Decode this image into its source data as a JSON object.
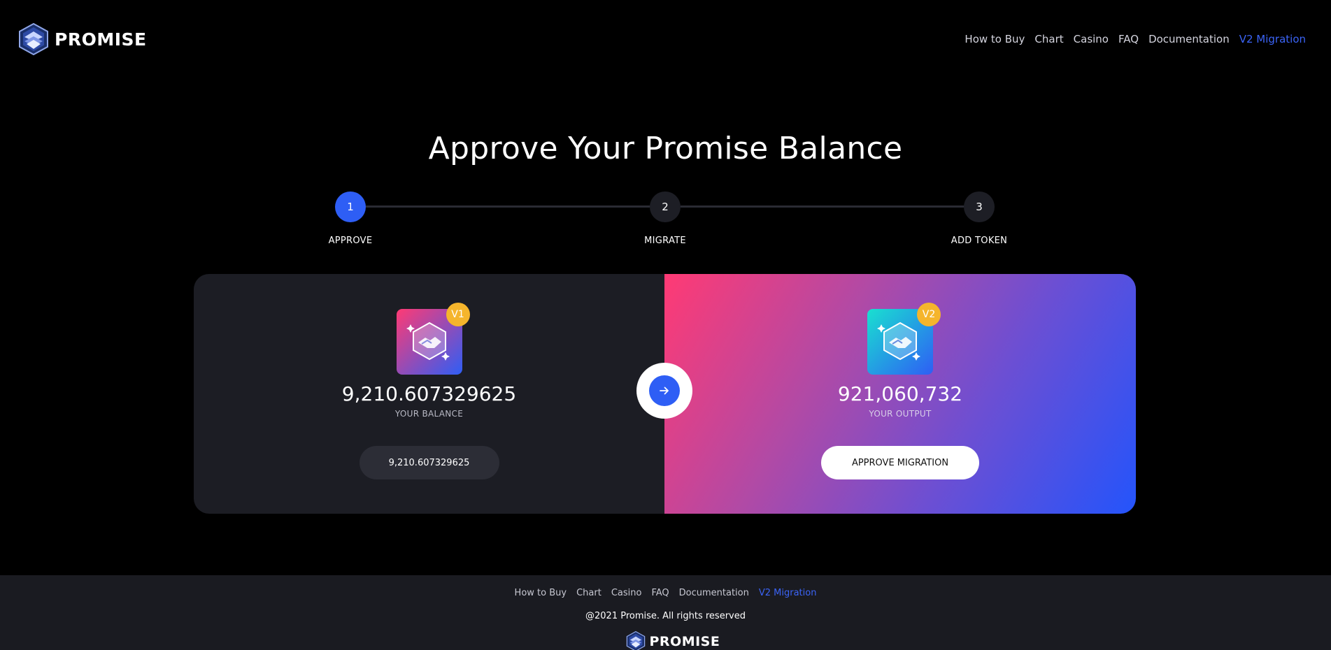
{
  "brand": {
    "name": "PROMISE",
    "logo_icon": "promise-logo-icon"
  },
  "nav": {
    "items": [
      {
        "label": "How to Buy"
      },
      {
        "label": "Chart"
      },
      {
        "label": "Casino"
      },
      {
        "label": "FAQ"
      },
      {
        "label": "Documentation"
      },
      {
        "label": "V2 Migration",
        "active": true
      }
    ]
  },
  "page": {
    "title": "Approve Your Promise Balance"
  },
  "stepper": {
    "steps": [
      {
        "number": "1",
        "label": "APPROVE",
        "active": true
      },
      {
        "number": "2",
        "label": "MIGRATE"
      },
      {
        "number": "3",
        "label": "ADD TOKEN"
      }
    ]
  },
  "migration": {
    "v1": {
      "badge": "V1",
      "amount": "9,210.607329625",
      "label": "YOUR BALANCE",
      "pill_value": "9,210.607329625",
      "icon": "handshake-token-icon"
    },
    "v2": {
      "badge": "V2",
      "amount": "921,060,732",
      "label": "YOUR OUTPUT",
      "button_label": "APPROVE MIGRATION",
      "icon": "handshake-token-icon"
    },
    "arrow_icon": "arrow-right-icon"
  },
  "footer": {
    "nav": [
      {
        "label": "How to Buy"
      },
      {
        "label": "Chart"
      },
      {
        "label": "Casino"
      },
      {
        "label": "FAQ"
      },
      {
        "label": "Documentation"
      },
      {
        "label": "V2 Migration",
        "active": true
      }
    ],
    "copyright": "@2021 Promise. All rights reserved",
    "brand": "PROMISE"
  },
  "colors": {
    "accent": "#2e5ef5",
    "link_active": "#3b64f7",
    "badge": "#f5b52c",
    "background": "#000000",
    "card_dark": "#1c1d24",
    "gradient_pink": "#ff3a74",
    "gradient_blue": "#2454fb"
  }
}
